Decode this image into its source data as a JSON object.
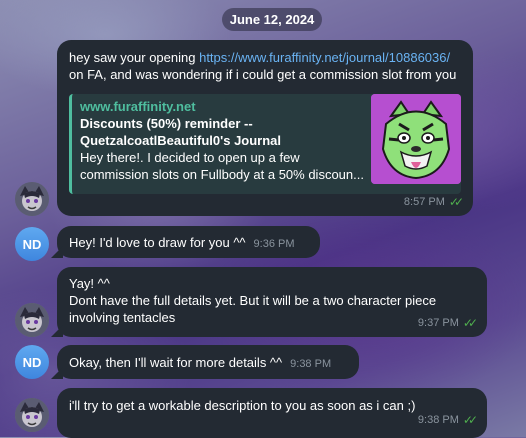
{
  "date_separator": "June 12, 2024",
  "messages": [
    {
      "sender": "them",
      "text_before": "hey saw your opening ",
      "link": "https://www.furaffinity.net/journal/10886036/",
      "text_after": "on FA, and was wondering if i could get a commission slot from you",
      "preview": {
        "site": "www.furaffinity.net",
        "title_line1": "Discounts (50%) reminder --",
        "title_line2": "QuetzalcoatlBeautiful0's Journal",
        "desc_line1": "Hey there!. I decided to open up a few",
        "desc_line2": "commission slots on Fullbody at a 50% discoun..."
      },
      "time": "8:57 PM",
      "read": true
    },
    {
      "sender": "me",
      "initials": "ND",
      "text": "Hey! I'd love to draw for you ^^",
      "time": "9:36 PM"
    },
    {
      "sender": "them",
      "line1": "Yay! ^^",
      "line2": "Dont have the full details yet. But it will be a two character piece",
      "line3": "involving tentacles",
      "time": "9:37 PM",
      "read": true
    },
    {
      "sender": "me",
      "initials": "ND",
      "text": "Okay, then I'll wait for more details ^^",
      "time": "9:38 PM"
    },
    {
      "sender": "them",
      "text": "i'll try to get a workable description to you as soon as i can ;)",
      "time": "9:38 PM",
      "read": true
    }
  ],
  "colors": {
    "bubble": "#232a33",
    "link": "#6ab3f3",
    "preview_accent": "#4fbe9f",
    "read_ticks": "#4fae4e",
    "initials_avatar": "#4a93e6"
  },
  "icons": {
    "read_receipt": "double-check-icon",
    "contact_avatar": "avatar-image",
    "preview_thumbnail": "tiger-face-thumbnail"
  }
}
